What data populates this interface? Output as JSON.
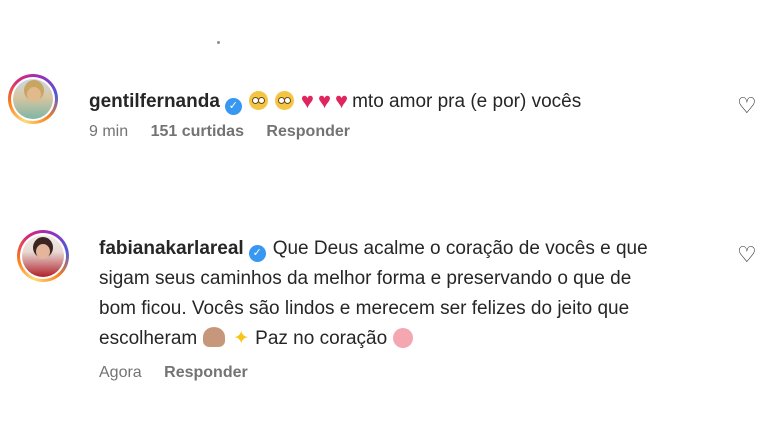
{
  "comments": [
    {
      "username": "gentilfernanda",
      "verified": true,
      "emoji_prefix": [
        "pleading-face",
        "pleading-face",
        "red-heart",
        "red-heart",
        "red-heart"
      ],
      "text": "mto amor pra (e por) vocês",
      "time": "9 min",
      "likes": "151 curtidas",
      "reply": "Responder",
      "like_icon": "heart-outline-icon"
    },
    {
      "username": "fabianakarlareal",
      "verified": true,
      "text_line1": "Que Deus acalme o coração de vocês e que",
      "text_line2": "sigam seus caminhos da melhor forma e preservando o que de",
      "text_line3": "bom ficou. Vocês são lindos e merecem ser felizes do jeito que",
      "text_line4a": "escolheram",
      "text_line4b": "Paz no coração",
      "emoji_inline": [
        "folded-hands",
        "sparkles",
        "smiling-face-with-hearts"
      ],
      "time": "Agora",
      "reply": "Responder",
      "like_icon": "heart-outline-icon"
    }
  ],
  "verified_glyph": "✓",
  "like_glyph": "♡",
  "colors": {
    "verified": "#3897f0",
    "heart": "#e0245e",
    "meta": "#737373",
    "text": "#262626"
  }
}
